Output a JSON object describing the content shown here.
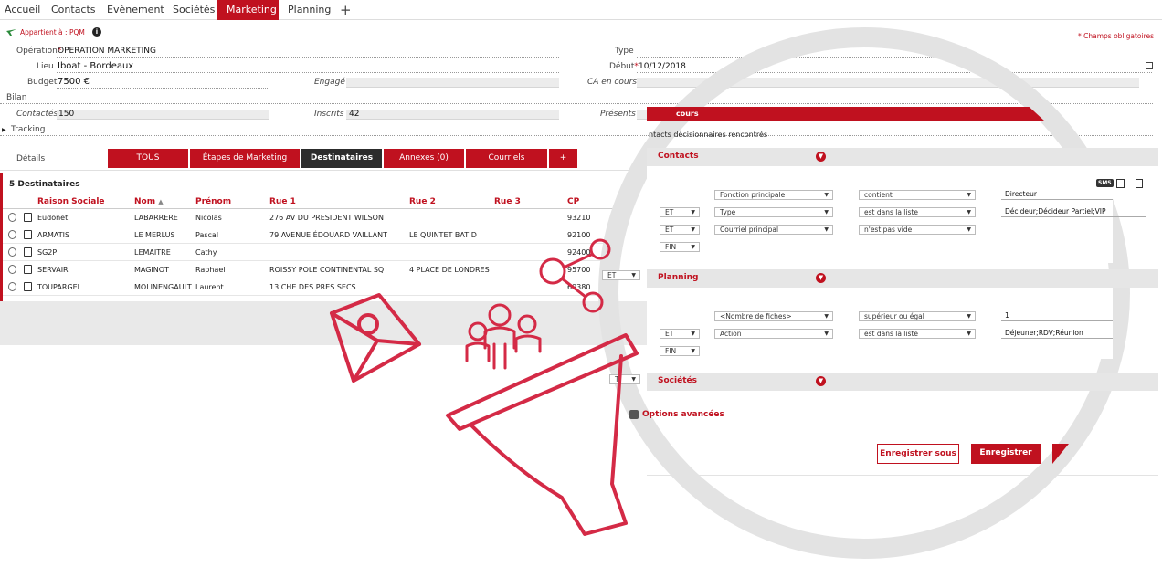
{
  "nav": {
    "tabs": [
      {
        "label": "Accueil"
      },
      {
        "label": "Contacts"
      },
      {
        "label": "Evènement"
      },
      {
        "label": "Sociétés"
      },
      {
        "label": "Marketing"
      },
      {
        "label": "Planning"
      }
    ],
    "add_label": "+"
  },
  "header": {
    "owner": "Appartient à : PQM",
    "required_note": "* Champs obligatoires"
  },
  "form": {
    "operation_label": "Opération",
    "operation_value": "OPERATION MARKETING",
    "type_label": "Type",
    "lieu_label": "Lieu",
    "lieu_value": "Iboat - Bordeaux",
    "debut_label": "Début",
    "debut_value": "10/12/2018",
    "budget_label": "Budget",
    "budget_value": "7500 €",
    "engage_label": "Engagé",
    "ca_label": "CA en cours",
    "bilan_label": "Bilan",
    "contactes_label": "Contactés",
    "contactes_value": "150",
    "inscrits_label": "Inscrits",
    "inscrits_value": "42",
    "presents_label": "Présents",
    "tracking_label": "Tracking",
    "required_star": "*"
  },
  "details": {
    "label": "Détails",
    "tabs": [
      "TOUS",
      "Étapes de Marketing",
      "Destinataires",
      "Annexes (0)",
      "Courriels",
      "+"
    ]
  },
  "table": {
    "count": "5 Destinataires",
    "columns": [
      "Raison Sociale",
      "Nom",
      "Prénom",
      "Rue 1",
      "Rue 2",
      "Rue 3",
      "CP"
    ],
    "rows": [
      {
        "raison": "Eudonet",
        "nom": "LABARRERE",
        "prenom": "Nicolas",
        "rue1": "276 AV DU PRESIDENT WILSON",
        "rue2": "",
        "cp": "93210"
      },
      {
        "raison": "ARMATIS",
        "nom": "LE MERLUS",
        "prenom": "Pascal",
        "rue1": "79 AVENUE ÉDOUARD VAILLANT",
        "rue2": "LE QUINTET BAT D",
        "cp": "92100"
      },
      {
        "raison": "SG2P",
        "nom": "LEMAITRE",
        "prenom": "Cathy",
        "rue1": "",
        "rue2": "",
        "cp": "92400"
      },
      {
        "raison": "SERVAIR",
        "nom": "MAGINOT",
        "prenom": "Raphael",
        "rue1": "ROISSY POLE CONTINENTAL SQ",
        "rue2": "4 PLACE DE LONDRES",
        "cp": "95700"
      },
      {
        "raison": "TOUPARGEL",
        "nom": "MOLINENGAULT",
        "prenom": "Laurent",
        "rue1": "13 CHE DES PRES SECS",
        "rue2": "",
        "cp": "69380"
      }
    ],
    "et_select": "ET",
    "t_select": "T"
  },
  "filter": {
    "banner": "cours",
    "subtitle": "ntacts décisionnaires rencontrés",
    "contacts": {
      "title": "Contacts",
      "rows": [
        {
          "op": "",
          "field": "Fonction principale",
          "cond": "contient",
          "value": "Directeur"
        },
        {
          "op": "ET",
          "field": "Type",
          "cond": "est dans la liste",
          "value": "Décideur;Décideur Partiel;VIP"
        },
        {
          "op": "ET",
          "field": "Courriel principal",
          "cond": "n'est pas vide",
          "value": ""
        },
        {
          "op": "FIN",
          "field": "",
          "cond": "",
          "value": ""
        }
      ]
    },
    "planning": {
      "title": "Planning",
      "rows": [
        {
          "op": "",
          "field": "<Nombre de fiches>",
          "cond": "supérieur ou égal",
          "value": "1"
        },
        {
          "op": "ET",
          "field": "Action",
          "cond": "est dans la liste",
          "value": "Déjeuner;RDV;Réunion"
        },
        {
          "op": "FIN",
          "field": "",
          "cond": "",
          "value": ""
        }
      ]
    },
    "societes": {
      "title": "Sociétés"
    },
    "advanced": "Options avancées",
    "save_as": "Enregistrer sous",
    "save": "Enregistrer",
    "sms_label": "SMS"
  },
  "colors": {
    "accent": "#c0111f",
    "dark_tab": "#2c2c2c",
    "graphic": "#d42a46",
    "circle": "#e3e3e3"
  }
}
